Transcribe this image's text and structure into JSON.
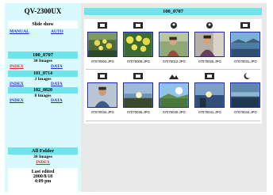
{
  "app": {
    "title": "QV-2300UX"
  },
  "sidebar": {
    "slide_show_label": "Slide show",
    "manual_label": "MANUAL",
    "auto_label": "AUTO",
    "folders": [
      {
        "name": "100_0707",
        "count": "30 Images",
        "index_label": "INDEX",
        "data_label": "DATA",
        "active": true
      },
      {
        "name": "101_0714",
        "count": "3 Images",
        "index_label": "INDEX",
        "data_label": "DATA",
        "active": false
      },
      {
        "name": "102_0820",
        "count": "8 Images",
        "index_label": "INDEX",
        "data_label": "DATA",
        "active": false
      }
    ],
    "all_folder": {
      "label": "All Folder",
      "count": "30 Images",
      "index_label": "INDEX"
    },
    "last_edited": {
      "label": "Last edited",
      "date": "2000/8/18",
      "time": "4:09 pm"
    }
  },
  "main": {
    "folder_title": "100_0707",
    "files": [
      {
        "name": "07070003.JPG",
        "icon": "camera-icon"
      },
      {
        "name": "07070009.JPG",
        "icon": "camera-icon"
      },
      {
        "name": "07070012.JPG",
        "icon": "portrait-icon"
      },
      {
        "name": "07070025.JPG",
        "icon": "portrait-icon"
      },
      {
        "name": "07070031.JPG",
        "icon": "camera-icon"
      },
      {
        "name": "07070034.JPG",
        "icon": "camera-icon"
      },
      {
        "name": "07070035.JPG",
        "icon": "camera-icon"
      },
      {
        "name": "07070040.JPG",
        "icon": "landscape-icon"
      },
      {
        "name": "07070041.JPG",
        "icon": "camera-icon"
      },
      {
        "name": "07070044.JPG",
        "icon": "night-icon"
      }
    ]
  },
  "colors": {
    "sidebar_bg": "#d8fafc",
    "accent_bar": "#6fe4ea",
    "link_blue": "#1a2bd1",
    "link_red": "#e0212a",
    "thumb_border": "#2027b0",
    "main_bg": "#e8e8e8"
  }
}
